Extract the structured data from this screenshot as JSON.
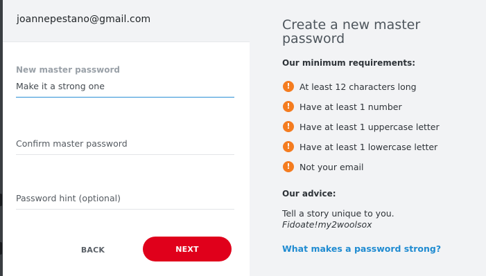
{
  "account": {
    "email": "joannepestano@gmail.com"
  },
  "form": {
    "new_password": {
      "label": "New master password",
      "placeholder": "Make it a strong one"
    },
    "confirm_password": {
      "placeholder": "Confirm master password"
    },
    "hint": {
      "placeholder": "Password hint (optional)"
    },
    "back_label": "BACK",
    "next_label": "NEXT"
  },
  "info": {
    "title": "Create a new master password",
    "requirements_heading": "Our minimum requirements:",
    "requirements": [
      {
        "text": "At least 12 characters long",
        "icon": "warning-icon"
      },
      {
        "text": "Have at least 1 number",
        "icon": "warning-icon"
      },
      {
        "text": "Have at least 1 uppercase letter",
        "icon": "warning-icon"
      },
      {
        "text": "Have at least 1 lowercase letter",
        "icon": "warning-icon"
      },
      {
        "text": "Not your email",
        "icon": "warning-icon"
      }
    ],
    "advice_heading": "Our advice:",
    "advice_text": "Tell a story unique to you.",
    "advice_example": "Fidoate!my2woolsox",
    "link_label": "What makes a password strong?"
  },
  "colors": {
    "accent_red": "#e0001b",
    "warning_orange": "#f47c20",
    "link_blue": "#1f8bd1",
    "focus_blue": "#2a8fd6"
  }
}
